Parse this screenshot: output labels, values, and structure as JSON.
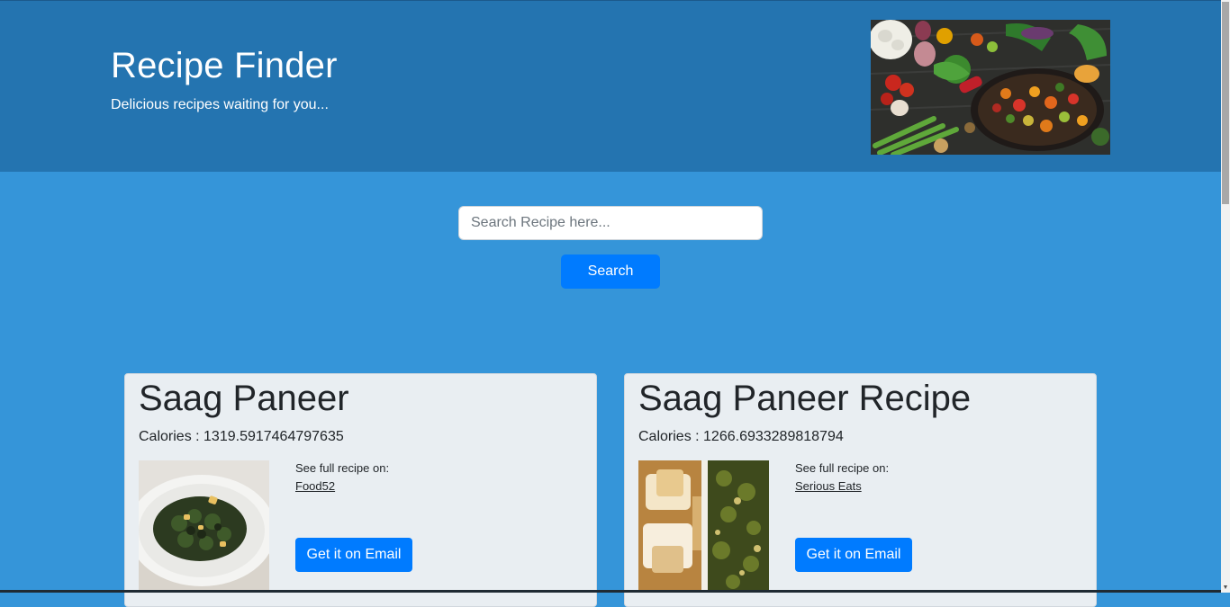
{
  "header": {
    "title": "Recipe Finder",
    "subtitle": "Delicious recipes waiting for you..."
  },
  "search": {
    "placeholder": "Search Recipe here...",
    "value": "",
    "button_label": "Search"
  },
  "recipes": [
    {
      "title": "Saag Paneer",
      "calories_label": "Calories : 1319.5917464797635",
      "see_full_label": "See full recipe on:",
      "source": "Food52",
      "email_button_label": "Get it on Email"
    },
    {
      "title": "Saag Paneer Recipe",
      "calories_label": "Calories : 1266.6933289818794",
      "see_full_label": "See full recipe on:",
      "source": "Serious Eats",
      "email_button_label": "Get it on Email"
    }
  ],
  "colors": {
    "header_bg": "#2474b0",
    "page_bg": "#3595d9",
    "button_bg": "#007bff",
    "card_bg": "#e9eef2"
  }
}
